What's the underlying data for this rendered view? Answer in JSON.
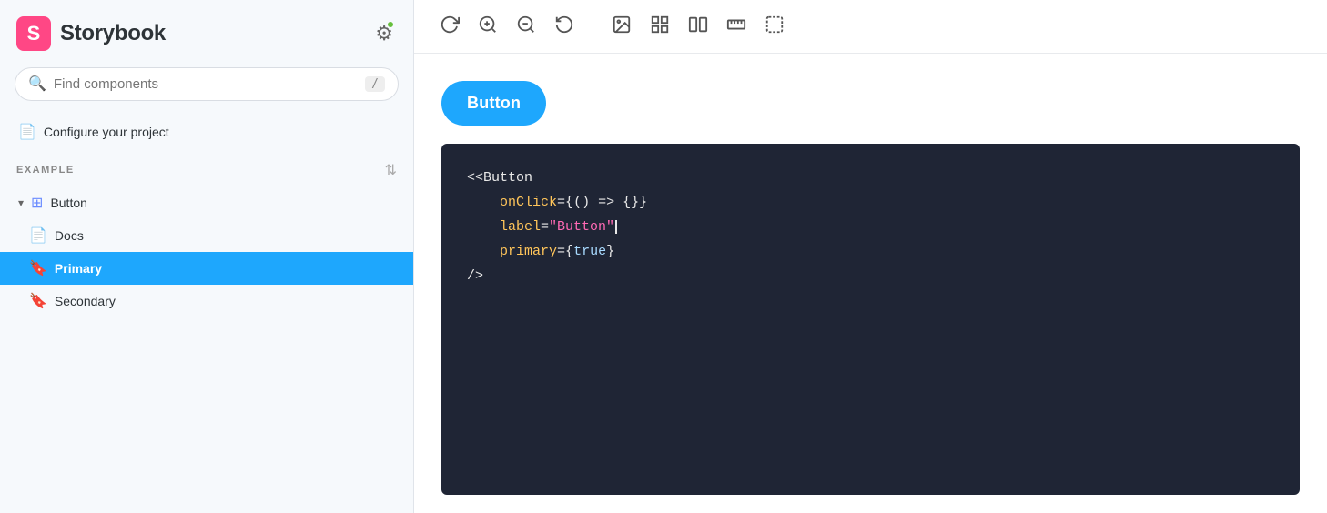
{
  "sidebar": {
    "logo_text": "Storybook",
    "search_placeholder": "Find components",
    "search_slash": "/",
    "configure_label": "Configure your project",
    "section_label": "EXAMPLE",
    "nav_items": [
      {
        "id": "button-group",
        "label": "Button",
        "icon": "grid",
        "indent": 0,
        "chevron": true
      },
      {
        "id": "docs",
        "label": "Docs",
        "icon": "doc",
        "indent": 1
      },
      {
        "id": "primary",
        "label": "Primary",
        "icon": "bookmark",
        "indent": 1,
        "active": true
      },
      {
        "id": "secondary",
        "label": "Secondary",
        "icon": "bookmark-teal",
        "indent": 1
      }
    ]
  },
  "toolbar": {
    "buttons": [
      {
        "id": "reload",
        "icon": "↺",
        "title": "Reload"
      },
      {
        "id": "zoom-in",
        "icon": "⊕",
        "title": "Zoom In"
      },
      {
        "id": "zoom-out",
        "icon": "⊖",
        "title": "Zoom Out"
      },
      {
        "id": "reset-zoom",
        "icon": "↺",
        "title": "Reset Zoom"
      }
    ]
  },
  "preview": {
    "button_label": "Button"
  },
  "code": {
    "line1": "<Button",
    "line2_attr": "onClick",
    "line2_value": "{() => {}}",
    "line3_attr": "label",
    "line3_value": "\"Button\"",
    "line4_attr": "primary",
    "line4_value": "{true}",
    "line5": "/>"
  }
}
